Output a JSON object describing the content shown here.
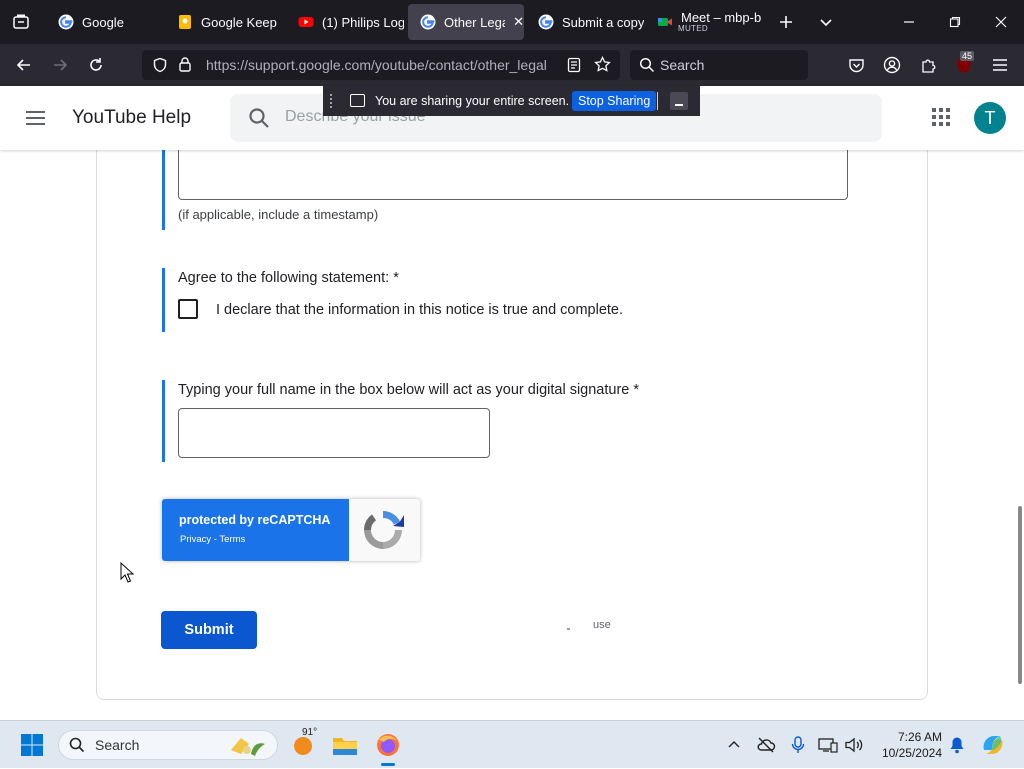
{
  "browser": {
    "tabs": [
      {
        "title": "Google",
        "favicon": "google-icon"
      },
      {
        "title": "Google Keep",
        "favicon": "keep-icon"
      },
      {
        "title": "(1) Philips Log",
        "favicon": "youtube-icon"
      },
      {
        "title": "Other Legal",
        "favicon": "google-icon",
        "active": true
      },
      {
        "title": "Submit a copy",
        "favicon": "google-icon"
      },
      {
        "title": "Meet – mbp-b",
        "subtitle": "MUTED",
        "favicon": "meet-icon"
      }
    ],
    "url": "https://support.google.com/youtube/contact/other_legal",
    "search_placeholder": "Search",
    "extension_badge": "45"
  },
  "screen_share": {
    "message": "You are sharing your entire screen.",
    "stop_label": "Stop Sharing"
  },
  "header": {
    "site_title": "YouTube Help",
    "search_placeholder": "Describe your issue",
    "avatar_letter": "T"
  },
  "form": {
    "timestamp_hint": "(if applicable, include a timestamp)",
    "agree_label": "Agree to the following statement: *",
    "declaration": "I declare that the information in this notice is true and complete.",
    "signature_label": "Typing your full name in the box below will act as your digital signature *",
    "signature_value": "",
    "recaptcha_title": "protected by reCAPTCHA",
    "recaptcha_links": "Privacy - Terms",
    "submit_label": "Submit",
    "fragment_text": "use"
  },
  "taskbar": {
    "search_label": "Search",
    "weather": "91°",
    "time": "7:26 AM",
    "date": "10/25/2024"
  },
  "colors": {
    "accent_blue": "#1a73e8",
    "submit_blue": "#0b57d0",
    "avatar_teal": "#00838f",
    "browser_dark": "#1c1b22"
  }
}
